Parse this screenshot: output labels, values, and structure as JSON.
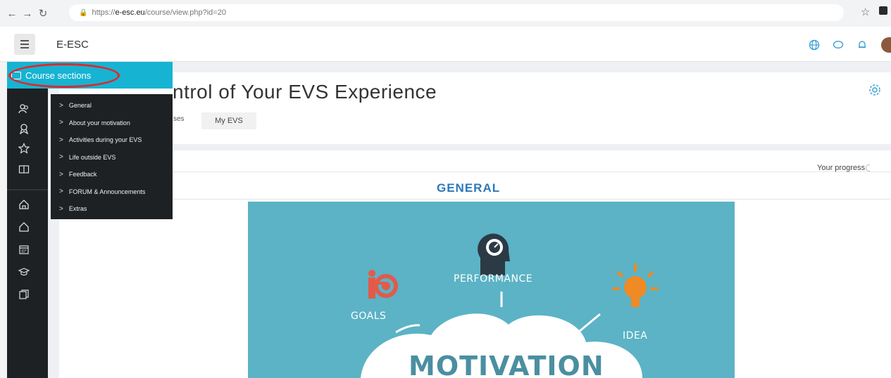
{
  "browser": {
    "url_prefix": "https://",
    "url_domain": "e-esc.eu",
    "url_path": "/course/view.php?id=20"
  },
  "navbar": {
    "site_name": "E-ESC"
  },
  "drawer": {
    "course_sections_label": "Course sections",
    "icons": [
      "users-icon",
      "badge-icon",
      "star-icon",
      "book-icon",
      "home-icon",
      "dashboard-icon",
      "calendar-icon",
      "graduation-icon",
      "files-icon"
    ]
  },
  "section_menu": {
    "items": [
      {
        "label": "General"
      },
      {
        "label": "About your motivation"
      },
      {
        "label": "Activities during your EVS"
      },
      {
        "label": "Life outside EVS"
      },
      {
        "label": "Feedback"
      },
      {
        "label": "FORUM & Announcements"
      },
      {
        "label": "Extras"
      }
    ]
  },
  "page": {
    "title_visible": "ntrol of Your EVS Experience",
    "breadcrumb_partial": "ses",
    "breadcrumb_current": "My EVS",
    "progress_label": "Your progress",
    "section_heading": "GENERAL"
  },
  "image": {
    "labels": [
      "GOALS",
      "PERFORMANCE",
      "IDEA"
    ],
    "big_text": "MOTIVATION"
  },
  "colors": {
    "accent": "#17b3d2",
    "drawer_bg": "#1e2124",
    "heading_blue": "#2d78b8",
    "highlight_red": "#e02828",
    "image_bg": "#5bb3c5",
    "icon_orange": "#f08a24",
    "icon_red": "#e35a4a"
  }
}
